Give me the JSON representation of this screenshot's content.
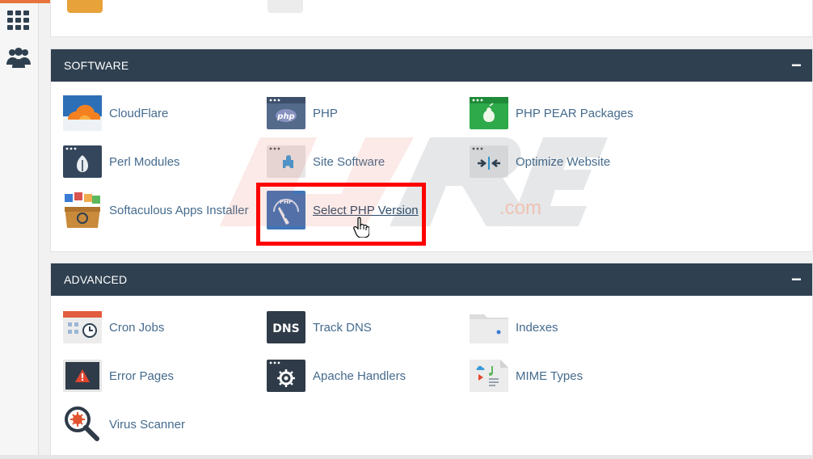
{
  "sections": {
    "software": {
      "title": "SOFTWARE",
      "toggle": "−",
      "items": [
        {
          "label": "CloudFlare",
          "icon": "cloudflare-icon"
        },
        {
          "label": "PHP",
          "icon": "php-icon"
        },
        {
          "label": "PHP PEAR Packages",
          "icon": "php-pear-icon"
        },
        {
          "label": "Perl Modules",
          "icon": "perl-modules-icon"
        },
        {
          "label": "Site Software",
          "icon": "site-software-icon"
        },
        {
          "label": "Optimize Website",
          "icon": "optimize-website-icon"
        },
        {
          "label": "Softaculous Apps Installer",
          "icon": "softaculous-icon"
        },
        {
          "label": "Select PHP Version",
          "icon": "select-php-version-icon"
        }
      ]
    },
    "advanced": {
      "title": "ADVANCED",
      "toggle": "−",
      "items": [
        {
          "label": "Cron Jobs",
          "icon": "cron-jobs-icon"
        },
        {
          "label": "Track DNS",
          "icon": "track-dns-icon"
        },
        {
          "label": "Indexes",
          "icon": "indexes-icon"
        },
        {
          "label": "Error Pages",
          "icon": "error-pages-icon"
        },
        {
          "label": "Apache Handlers",
          "icon": "apache-handlers-icon"
        },
        {
          "label": "MIME Types",
          "icon": "mime-types-icon"
        },
        {
          "label": "Virus Scanner",
          "icon": "virus-scanner-icon"
        }
      ]
    }
  },
  "icons_text": {
    "php_badge": "php",
    "dns_badge": "DNS",
    "php_small": "PHP"
  },
  "watermark": {
    "suffix": ".com"
  },
  "colors": {
    "header_bg": "#2f4050",
    "link": "#456b8e",
    "highlight": "#ff0000",
    "accent": "#e9743b"
  }
}
